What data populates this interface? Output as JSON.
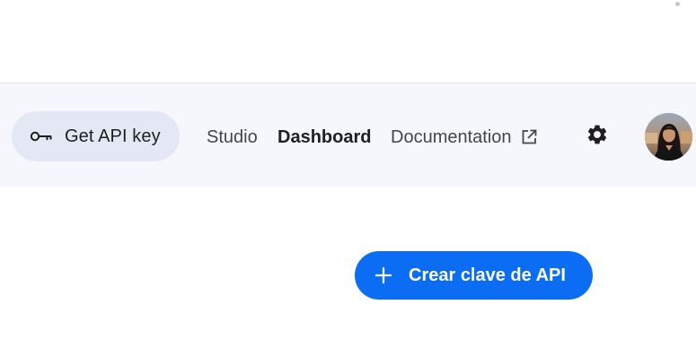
{
  "header": {
    "api_key_button": {
      "label": "Get API key",
      "icon": "key-icon"
    },
    "nav": {
      "studio": "Studio",
      "dashboard": "Dashboard",
      "documentation": "Documentation",
      "documentation_icon": "open-in-new-icon"
    },
    "settings_icon": "gear-icon",
    "active_link": "Dashboard"
  },
  "main": {
    "create_button": {
      "label": "Crear clave de API",
      "icon": "plus-icon"
    }
  },
  "colors": {
    "nav_background": "#f5f7fc",
    "pill_background": "#e3e8f4",
    "primary_button": "#0b6df3",
    "text_primary": "#1f1f1f",
    "text_secondary": "#444746"
  }
}
